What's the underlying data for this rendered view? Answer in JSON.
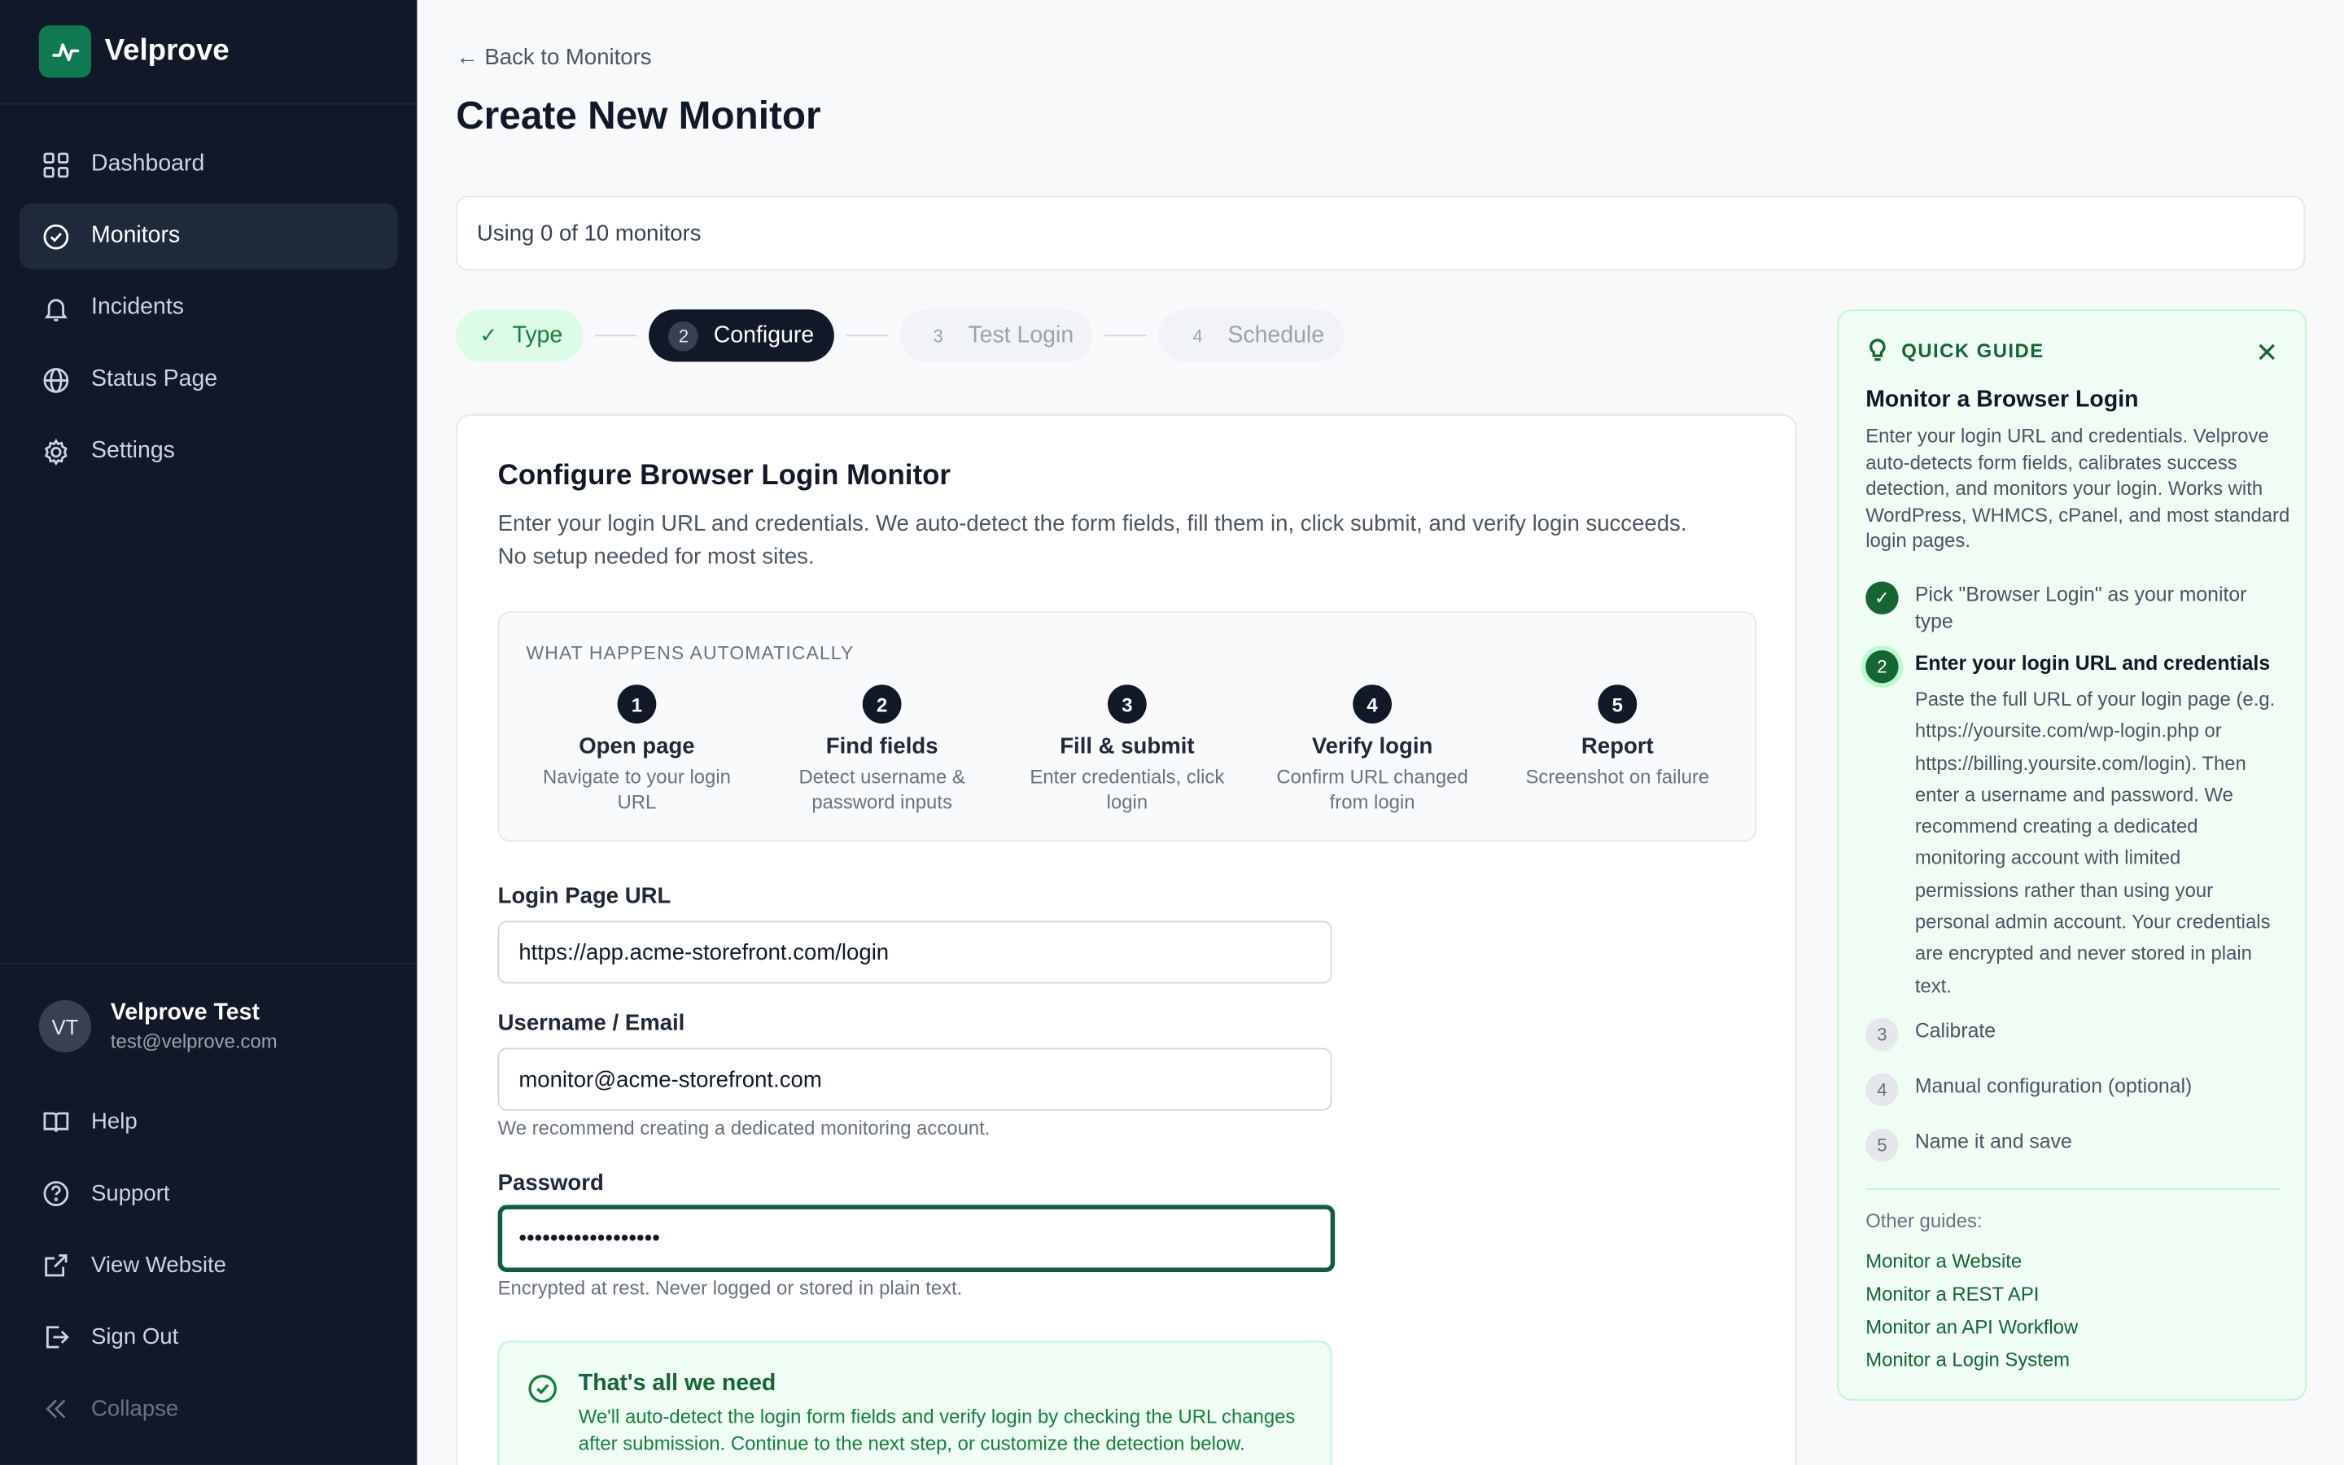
{
  "brand": {
    "name": "Velprove"
  },
  "sidebar": {
    "items": [
      {
        "label": "Dashboard"
      },
      {
        "label": "Monitors"
      },
      {
        "label": "Incidents"
      },
      {
        "label": "Status Page"
      },
      {
        "label": "Settings"
      }
    ],
    "user": {
      "initials": "VT",
      "name": "Velprove Test",
      "email": "test@velprove.com"
    },
    "bottom": [
      {
        "label": "Help"
      },
      {
        "label": "Support"
      },
      {
        "label": "View Website"
      },
      {
        "label": "Sign Out"
      },
      {
        "label": "Collapse"
      }
    ]
  },
  "header": {
    "back": "← Back to Monitors",
    "title": "Create New Monitor",
    "usage": "Using 0 of 10 monitors"
  },
  "stepper": [
    {
      "num": "",
      "label": "Type",
      "state": "done"
    },
    {
      "num": "2",
      "label": "Configure",
      "state": "active"
    },
    {
      "num": "3",
      "label": "Test Login",
      "state": "todo"
    },
    {
      "num": "4",
      "label": "Schedule",
      "state": "todo"
    }
  ],
  "form": {
    "title": "Configure Browser Login Monitor",
    "description": "Enter your login URL and credentials. We auto-detect the form fields, fill them in, click submit, and verify login succeeds. No setup needed for most sites.",
    "auto_title": "WHAT HAPPENS AUTOMATICALLY",
    "auto_steps": [
      {
        "num": "1",
        "name": "Open page",
        "sub": "Navigate to your login URL"
      },
      {
        "num": "2",
        "name": "Find fields",
        "sub": "Detect username & password inputs"
      },
      {
        "num": "3",
        "name": "Fill & submit",
        "sub": "Enter credentials, click login"
      },
      {
        "num": "4",
        "name": "Verify login",
        "sub": "Confirm URL changed from login"
      },
      {
        "num": "5",
        "name": "Report",
        "sub": "Screenshot on failure"
      }
    ],
    "url_label": "Login Page URL",
    "url_value": "https://app.acme-storefront.com/login",
    "user_label": "Username / Email",
    "user_value": "monitor@acme-storefront.com",
    "user_help": "We recommend creating a dedicated monitoring account.",
    "pass_label": "Password",
    "pass_value": "••••••••••••••••••",
    "pass_help": "Encrypted at rest. Never logged or stored in plain text.",
    "success_title": "That's all we need",
    "success_text": "We'll auto-detect the login form fields and verify login by checking the URL changes after submission. Continue to the next step, or customize the detection below."
  },
  "guide": {
    "heading": "QUICK GUIDE",
    "title": "Monitor a Browser Login",
    "description": "Enter your login URL and credentials. Velprove auto-detects form fields, calibrates success detection, and monitors your login. Works with WordPress, WHMCS, cPanel, and most standard login pages.",
    "steps": [
      {
        "num": "✓",
        "text": "Pick \"Browser Login\" as your monitor type"
      },
      {
        "num": "2",
        "text": "Enter your login URL and credentials",
        "detail": "Paste the full URL of your login page (e.g. https://yoursite.com/wp-login.php or https://billing.yoursite.com/login). Then enter a username and password. We recommend creating a dedicated monitoring account with limited permissions rather than using your personal admin account. Your credentials are encrypted and never stored in plain text."
      },
      {
        "num": "3",
        "text": "Calibrate"
      },
      {
        "num": "4",
        "text": "Manual configuration (optional)"
      },
      {
        "num": "5",
        "text": "Name it and save"
      }
    ],
    "other_title": "Other guides:",
    "other": [
      "Monitor a Website",
      "Monitor a REST API",
      "Monitor an API Workflow",
      "Monitor a Login System"
    ]
  },
  "colors": {
    "accent": "#0f7a52",
    "sidebar": "#111827",
    "success": "#166534"
  }
}
